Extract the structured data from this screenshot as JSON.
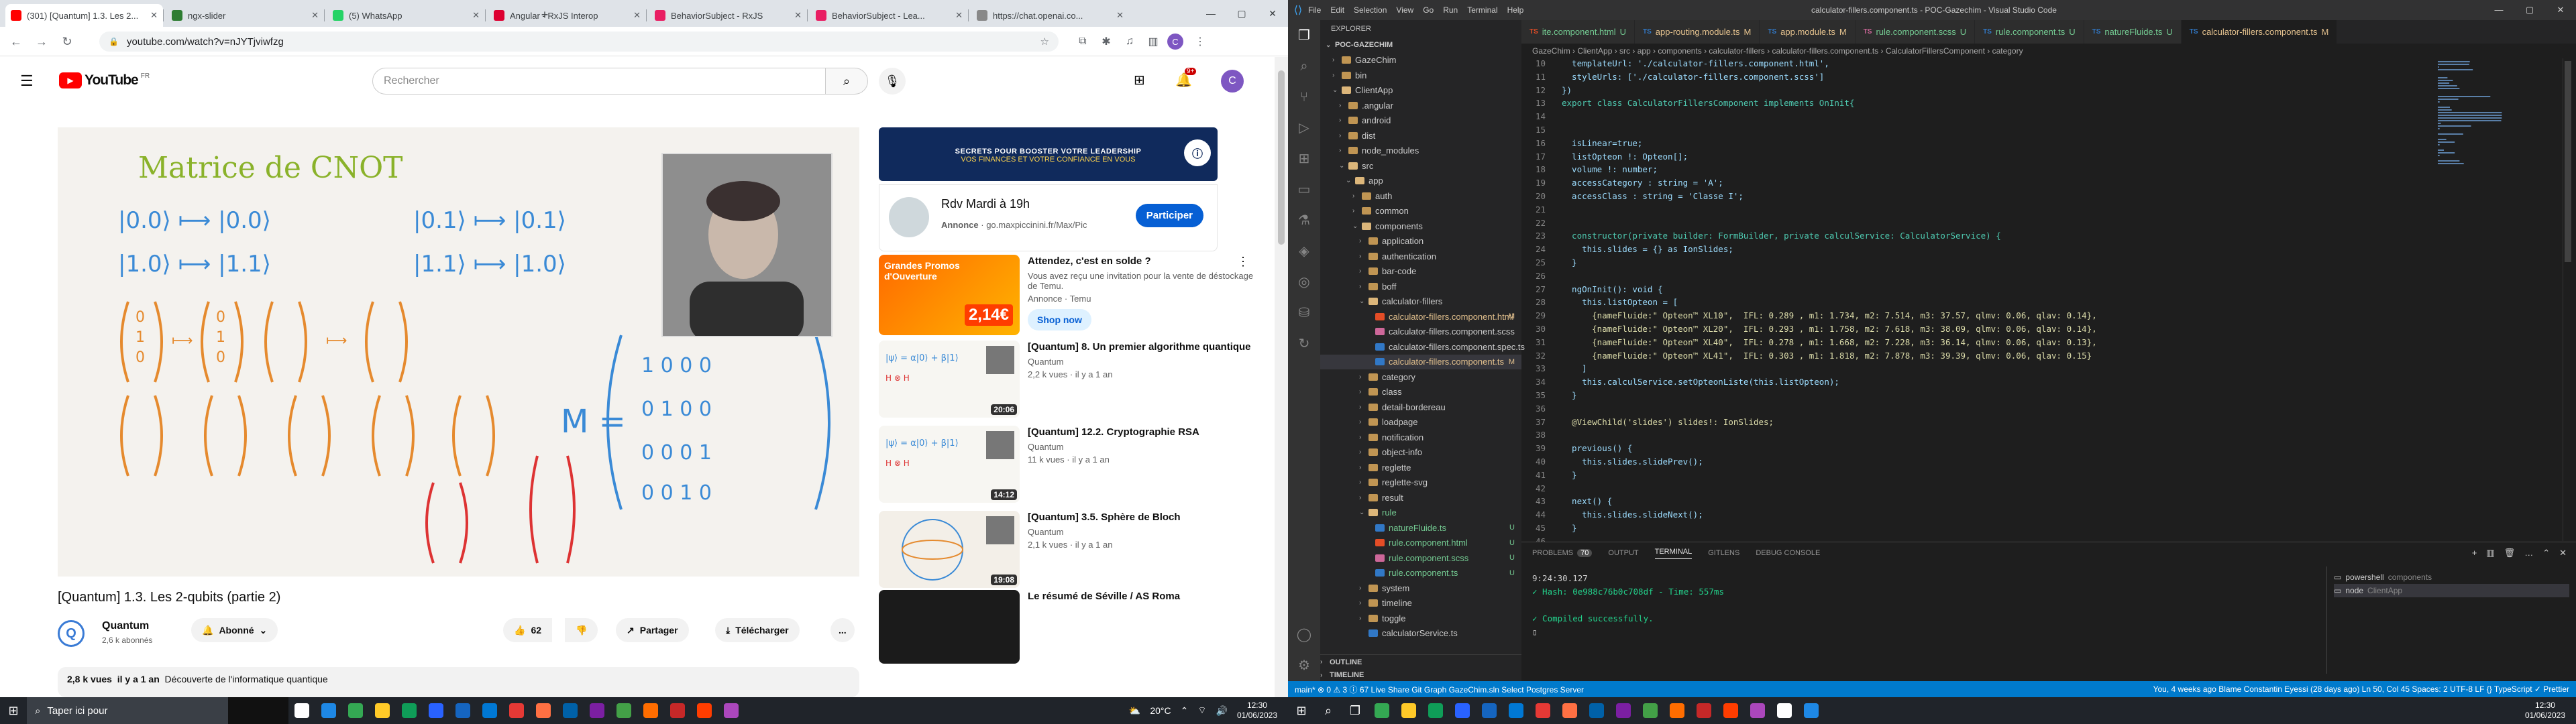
{
  "chrome": {
    "tabs": [
      {
        "label": "(301) [Quantum] 1.3. Les 2...",
        "fav_color": "#ff0000",
        "active": true
      },
      {
        "label": "ngx-slider",
        "fav_color": "#2e7d32",
        "active": false
      },
      {
        "label": "(5) WhatsApp",
        "fav_color": "#25d366",
        "active": false
      },
      {
        "label": "Angular - RxJS Interop",
        "fav_color": "#dd0031",
        "active": false
      },
      {
        "label": "BehaviorSubject - RxJS",
        "fav_color": "#e91e63",
        "active": false
      },
      {
        "label": "BehaviorSubject - Lea...",
        "fav_color": "#e91e63",
        "active": false
      },
      {
        "label": "https://chat.openai.co...",
        "fav_color": "#888888",
        "active": false
      }
    ],
    "new_tab": "+",
    "url": "youtube.com/watch?v=nJYTjviwfzg",
    "profile_initial": "C"
  },
  "youtube": {
    "logo_text": "YouTube",
    "logo_region": "FR",
    "search_placeholder": "Rechercher",
    "notif_count": "9+",
    "avatar_initial": "C",
    "video": {
      "board_title": "Matrice de CNOT",
      "title": "[Quantum] 1.3. Les 2-qubits (partie 2)",
      "channel": "Quantum",
      "subscribers": "2,6 k abonnés",
      "subscribed_label": "Abonné",
      "likes": "62",
      "share_label": "Partager",
      "download_label": "Télécharger",
      "more": "...",
      "views_line": "2,8 k vues",
      "age": "il y a 1 an",
      "desc": "Découverte de l'informatique quantique"
    },
    "ad_banner": {
      "text1": "SECRETS POUR BOOSTER VOTRE LEADERSHIP",
      "text2": "VOS FINANCES ET VOTRE CONFIANCE EN VOUS"
    },
    "ad_card": {
      "title": "Rdv Mardi à 19h",
      "label": "Annonce",
      "url": "go.maxpiccinini.fr/Max/Pic",
      "cta": "Participer"
    },
    "sidebar": [
      {
        "title": "Attendez, c'est en solde ?",
        "channel": "Vous avez reçu une invitation pour la vente de déstockage de Temu.",
        "meta": "Annonce · Temu",
        "cta": "Shop now",
        "duration": "",
        "thumb": "temu"
      },
      {
        "title": "[Quantum] 8. Un premier algorithme quantique",
        "channel": "Quantum",
        "meta": "2,2 k vues · il y a 1 an",
        "duration": "20:06",
        "thumb": "board"
      },
      {
        "title": "[Quantum] 12.2. Cryptographie RSA",
        "channel": "Quantum",
        "meta": "11 k vues · il y a 1 an",
        "duration": "14:12",
        "thumb": "board"
      },
      {
        "title": "[Quantum] 3.5. Sphère de Bloch",
        "channel": "Quantum",
        "meta": "2,1 k vues · il y a 1 an",
        "duration": "19:08",
        "thumb": "sphere"
      },
      {
        "title": "Le résumé de Séville / AS Roma",
        "channel": "",
        "meta": "",
        "duration": "",
        "thumb": "dark"
      }
    ]
  },
  "vscode": {
    "title": "calculator-fillers.component.ts - POC-Gazechim - Visual Studio Code",
    "menu": [
      "File",
      "Edit",
      "Selection",
      "View",
      "Go",
      "Run",
      "Terminal",
      "Help"
    ],
    "explorer_title": "EXPLORER",
    "tree": [
      {
        "label": "POC-GAZECHIM",
        "depth": 0,
        "type": "root",
        "marker": ""
      },
      {
        "label": "GazeChim",
        "depth": 1,
        "type": "folder",
        "marker": ""
      },
      {
        "label": "bin",
        "depth": 1,
        "type": "folder",
        "marker": ""
      },
      {
        "label": "ClientApp",
        "depth": 1,
        "type": "folder-open",
        "marker": ""
      },
      {
        "label": ".angular",
        "depth": 2,
        "type": "folder",
        "marker": ""
      },
      {
        "label": "android",
        "depth": 2,
        "type": "folder",
        "marker": ""
      },
      {
        "label": "dist",
        "depth": 2,
        "type": "folder",
        "marker": ""
      },
      {
        "label": "node_modules",
        "depth": 2,
        "type": "folder",
        "marker": ""
      },
      {
        "label": "src",
        "depth": 2,
        "type": "folder-open",
        "marker": ""
      },
      {
        "label": "app",
        "depth": 3,
        "type": "folder-open",
        "marker": ""
      },
      {
        "label": "auth",
        "depth": 4,
        "type": "folder",
        "marker": ""
      },
      {
        "label": "common",
        "depth": 4,
        "type": "folder",
        "marker": ""
      },
      {
        "label": "components",
        "depth": 4,
        "type": "folder-open",
        "marker": ""
      },
      {
        "label": "application",
        "depth": 5,
        "type": "folder",
        "marker": ""
      },
      {
        "label": "authentication",
        "depth": 5,
        "type": "folder",
        "marker": ""
      },
      {
        "label": "bar-code",
        "depth": 5,
        "type": "folder",
        "marker": ""
      },
      {
        "label": "boff",
        "depth": 5,
        "type": "folder",
        "marker": ""
      },
      {
        "label": "calculator-fillers",
        "depth": 5,
        "type": "folder-open",
        "marker": ""
      },
      {
        "label": "calculator-fillers.component.html",
        "depth": 6,
        "type": "html",
        "marker": "M"
      },
      {
        "label": "calculator-fillers.component.scss",
        "depth": 6,
        "type": "scss",
        "marker": ""
      },
      {
        "label": "calculator-fillers.component.spec.ts",
        "depth": 6,
        "type": "ts",
        "marker": ""
      },
      {
        "label": "calculator-fillers.component.ts",
        "depth": 6,
        "type": "ts-sel",
        "marker": "M"
      },
      {
        "label": "category",
        "depth": 5,
        "type": "folder",
        "marker": ""
      },
      {
        "label": "class",
        "depth": 5,
        "type": "folder",
        "marker": ""
      },
      {
        "label": "detail-bordereau",
        "depth": 5,
        "type": "folder",
        "marker": ""
      },
      {
        "label": "loadpage",
        "depth": 5,
        "type": "folder",
        "marker": ""
      },
      {
        "label": "notification",
        "depth": 5,
        "type": "folder",
        "marker": ""
      },
      {
        "label": "object-info",
        "depth": 5,
        "type": "folder",
        "marker": ""
      },
      {
        "label": "reglette",
        "depth": 5,
        "type": "folder",
        "marker": ""
      },
      {
        "label": "reglette-svg",
        "depth": 5,
        "type": "folder",
        "marker": ""
      },
      {
        "label": "result",
        "depth": 5,
        "type": "folder",
        "marker": ""
      },
      {
        "label": "rule",
        "depth": 5,
        "type": "folder-open-g",
        "marker": ""
      },
      {
        "label": "natureFluide.ts",
        "depth": 6,
        "type": "ts-g",
        "marker": "U"
      },
      {
        "label": "rule.component.html",
        "depth": 6,
        "type": "html-g",
        "marker": "U"
      },
      {
        "label": "rule.component.scss",
        "depth": 6,
        "type": "scss-g",
        "marker": "U"
      },
      {
        "label": "rule.component.ts",
        "depth": 6,
        "type": "ts-g",
        "marker": "U"
      },
      {
        "label": "system",
        "depth": 5,
        "type": "folder",
        "marker": ""
      },
      {
        "label": "timeline",
        "depth": 5,
        "type": "folder",
        "marker": ""
      },
      {
        "label": "toggle",
        "depth": 5,
        "type": "folder",
        "marker": ""
      },
      {
        "label": "calculatorService.ts",
        "depth": 5,
        "type": "ts",
        "marker": ""
      }
    ],
    "outline": "OUTLINE",
    "timeline": "TIMELINE",
    "tabs": [
      {
        "label": "ite.component.html",
        "marker": "U",
        "color": "#e44d26",
        "active": false
      },
      {
        "label": "app-routing.module.ts",
        "marker": "M",
        "color": "#3178c6",
        "active": false
      },
      {
        "label": "app.module.ts",
        "marker": "M",
        "color": "#3178c6",
        "active": false
      },
      {
        "label": "rule.component.scss",
        "marker": "U",
        "color": "#cd6799",
        "active": false
      },
      {
        "label": "rule.component.ts",
        "marker": "U",
        "color": "#3178c6",
        "active": false
      },
      {
        "label": "natureFluide.ts",
        "marker": "U",
        "color": "#3178c6",
        "active": false
      },
      {
        "label": "calculator-fillers.component.ts",
        "marker": "M",
        "color": "#3178c6",
        "active": true
      }
    ],
    "breadcrumb": "GazeChim › ClientApp › src › app › components › calculator-fillers › calculator-fillers.component.ts › CalculatorFillersComponent › category",
    "code": [
      {
        "n": "10",
        "t": "  templateUrl: './calculator-fillers.component.html',"
      },
      {
        "n": "11",
        "t": "  styleUrls: ['./calculator-fillers.component.scss']"
      },
      {
        "n": "12",
        "t": "})"
      },
      {
        "n": "13",
        "t": "export class CalculatorFillersComponent implements OnInit{"
      },
      {
        "n": "14",
        "t": ""
      },
      {
        "n": "15",
        "t": ""
      },
      {
        "n": "16",
        "t": "  isLinear=true;"
      },
      {
        "n": "17",
        "t": "  listOpteon !: Opteon[];"
      },
      {
        "n": "18",
        "t": "  volume !: number;"
      },
      {
        "n": "19",
        "t": "  accessCategory : string = 'A';"
      },
      {
        "n": "20",
        "t": "  accessClass : string = 'Classe I';"
      },
      {
        "n": "21",
        "t": ""
      },
      {
        "n": "22",
        "t": ""
      },
      {
        "n": "23",
        "t": "  constructor(private builder: FormBuilder, private calculService: CalculatorService) {"
      },
      {
        "n": "24",
        "t": "    this.slides = {} as IonSlides;"
      },
      {
        "n": "25",
        "t": "  }"
      },
      {
        "n": "26",
        "t": ""
      },
      {
        "n": "27",
        "t": "  ngOnInit(): void {"
      },
      {
        "n": "28",
        "t": "    this.listOpteon = ["
      },
      {
        "n": "29",
        "t": "      {nameFluide:\" Opteon™ XL10\",  IFL: 0.289 , m1: 1.734, m2: 7.514, m3: 37.57, qlmv: 0.06, qlav: 0.14},"
      },
      {
        "n": "30",
        "t": "      {nameFluide:\" Opteon™ XL20\",  IFL: 0.293 , m1: 1.758, m2: 7.618, m3: 38.09, qlmv: 0.06, qlav: 0.14},"
      },
      {
        "n": "31",
        "t": "      {nameFluide:\" Opteon™ XL40\",  IFL: 0.278 , m1: 1.668, m2: 7.228, m3: 36.14, qlmv: 0.06, qlav: 0.13},"
      },
      {
        "n": "32",
        "t": "      {nameFluide:\" Opteon™ XL41\",  IFL: 0.303 , m1: 1.818, m2: 7.878, m3: 39.39, qlmv: 0.06, qlav: 0.15}"
      },
      {
        "n": "33",
        "t": "    ]"
      },
      {
        "n": "34",
        "t": "    this.calculService.setOpteonListe(this.listOpteon);"
      },
      {
        "n": "35",
        "t": "  }"
      },
      {
        "n": "36",
        "t": ""
      },
      {
        "n": "37",
        "t": "  @ViewChild('slides') slides!: IonSlides;"
      },
      {
        "n": "38",
        "t": ""
      },
      {
        "n": "39",
        "t": "  previous() {"
      },
      {
        "n": "40",
        "t": "    this.slides.slidePrev();"
      },
      {
        "n": "41",
        "t": "  }"
      },
      {
        "n": "42",
        "t": ""
      },
      {
        "n": "43",
        "t": "  next() {"
      },
      {
        "n": "44",
        "t": "    this.slides.slideNext();"
      },
      {
        "n": "45",
        "t": "  }"
      },
      {
        "n": "46",
        "t": ""
      },
      {
        "n": "47",
        "t": "  application = this.builder.group({"
      },
      {
        "n": "48",
        "t": "    //firstCtrl: ['', Validators.required],"
      }
    ],
    "panel_tabs": [
      "PROBLEMS",
      "OUTPUT",
      "TERMINAL",
      "GITLENS",
      "DEBUG CONSOLE"
    ],
    "problems_count": "70",
    "terminal": [
      "9:24:30.127",
      "✓ Hash: 0e988c76b0c708df - Time: 557ms",
      "",
      "✓ Compiled successfully.",
      "▯"
    ],
    "terminals": [
      {
        "label": "powershell",
        "sub": "components"
      },
      {
        "label": "node",
        "sub": "ClientApp"
      }
    ],
    "status_left": "main*   ⊗ 0 ⚠ 3 ⓘ 67   Live Share   Git Graph   GazeChim.sln   Select Postgres Server",
    "status_right": "You, 4 weeks ago   Blame Constantin Eyessi (28 days ago)   Ln 50, Col 45   Spaces: 2   UTF-8   LF   {} TypeScript   ✓ Prettier"
  },
  "taskbar_left": {
    "search_placeholder": "Taper ici pour",
    "weather": "20°C",
    "time": "12:30",
    "date": "01/06/2023"
  },
  "taskbar_right": {
    "time": "12:30",
    "date": "01/06/2023"
  }
}
